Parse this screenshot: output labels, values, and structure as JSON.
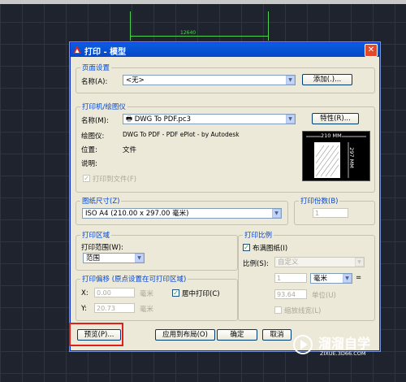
{
  "background": {
    "cad_dimension_text": "12640"
  },
  "dialog": {
    "title": "打印 - 模型",
    "close_glyph": "✕",
    "page_setup": {
      "legend": "页面设置",
      "name_label": "名称(A):",
      "name_value": "<无>",
      "add_button": "添加(.)..."
    },
    "printer": {
      "legend": "打印机/绘图仪",
      "name_label": "名称(M):",
      "name_value": "DWG To PDF.pc3",
      "properties_button": "特性(R)...",
      "plotter_label": "绘图仪:",
      "plotter_value": "DWG To PDF - PDF ePlot - by Autodesk",
      "location_label": "位置:",
      "location_value": "文件",
      "description_label": "说明:",
      "plot_to_file_label": "打印到文件(F)",
      "plot_to_file_checked": true,
      "preview_width": "210 MM",
      "preview_height": "297 MM"
    },
    "paper_size": {
      "legend": "图纸尺寸(Z)",
      "value": "ISO A4 (210.00 x 297.00 毫米)"
    },
    "copies": {
      "legend": "打印份数(B)",
      "value": "1"
    },
    "plot_area": {
      "legend": "打印区域",
      "range_label": "打印范围(W):",
      "range_value": "范围"
    },
    "plot_scale": {
      "legend": "打印比例",
      "fit_to_paper_label": "布满图纸(I)",
      "fit_to_paper_checked": true,
      "scale_label": "比例(S):",
      "scale_value": "自定义",
      "scale_num": "1",
      "unit_value": "毫米",
      "equals": "=",
      "scale_den": "93.64",
      "unit_label": "单位(U)",
      "linewidth_label": "缩放线宽(L)"
    },
    "plot_offset": {
      "legend": "打印偏移 (原点设置在可打印区域)",
      "x_label": "X:",
      "x_value": "0.00",
      "x_unit": "毫米",
      "center_label": "居中打印(C)",
      "center_checked": true,
      "y_label": "Y:",
      "y_value": "20.73",
      "y_unit": "毫米"
    },
    "buttons": {
      "preview": "预览(P)...",
      "apply_layout": "应用到布局(O)",
      "ok": "确定",
      "cancel": "取消"
    }
  },
  "watermark": {
    "brand": "溜溜自学",
    "url": "ZIXUE.3D66.COM"
  },
  "colors": {
    "accent": "#0a5fe0",
    "highlight": "#e0201a",
    "cad_green": "#4fd24f"
  }
}
